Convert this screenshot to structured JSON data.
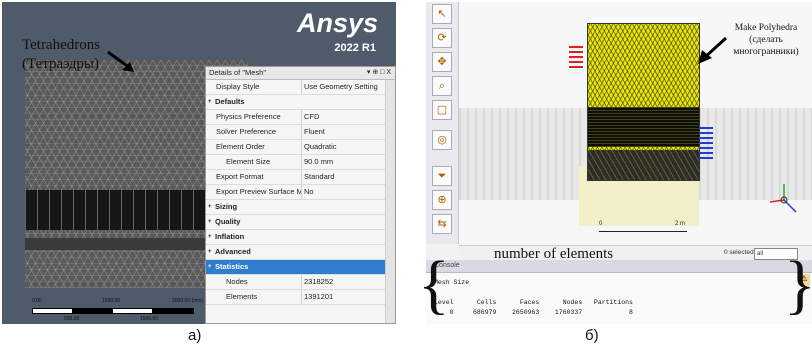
{
  "panel_a": {
    "logo": "Ansys",
    "version": "2022 R1",
    "annotation": [
      "Tetrahedrons",
      "(Тетраэдры)"
    ],
    "details": {
      "title": "Details of \"Mesh\"",
      "controls": "▾ ⊕ □ X",
      "rows": [
        {
          "key": "Display Style",
          "value": "Use Geometry Setting",
          "type": "row"
        },
        {
          "key": "Defaults",
          "value": "",
          "type": "grp"
        },
        {
          "key": "Physics Preference",
          "value": "CFD",
          "type": "row"
        },
        {
          "key": "Solver Preference",
          "value": "Fluent",
          "type": "row"
        },
        {
          "key": "Element Order",
          "value": "Quadratic",
          "type": "row"
        },
        {
          "key": "Element Size",
          "value": "90.0 mm",
          "type": "sub"
        },
        {
          "key": "Export Format",
          "value": "Standard",
          "type": "row"
        },
        {
          "key": "Export Preview Surface Mesh",
          "value": "No",
          "type": "row"
        },
        {
          "key": "Sizing",
          "value": "",
          "type": "grp"
        },
        {
          "key": "Quality",
          "value": "",
          "type": "grp"
        },
        {
          "key": "Inflation",
          "value": "",
          "type": "grp"
        },
        {
          "key": "Advanced",
          "value": "",
          "type": "grp"
        },
        {
          "key": "Statistics",
          "value": "",
          "type": "sel"
        },
        {
          "key": "Nodes",
          "value": "2318252",
          "type": "sub"
        },
        {
          "key": "Elements",
          "value": "1391201",
          "type": "sub"
        }
      ]
    },
    "scale": {
      "t0": "0.00",
      "t1": "1000.00",
      "t2": "2000.00 (mm)",
      "m1": "500.00",
      "m2": "1500.00"
    },
    "caption": "а)"
  },
  "panel_b": {
    "annotation": [
      "Make Polyhedra",
      "(сделать",
      "многогранники)"
    ],
    "ruler": [
      "0",
      "2 m"
    ],
    "status": {
      "selected": "0 selected",
      "filter": "all"
    },
    "console": {
      "tab": "Console",
      "heading": "number of elements",
      "lines": [
        "Mesh Size",
        "",
        "Level      Cells      Faces      Nodes   Partitions",
        "    0     686979    2650963    1760337            8"
      ]
    },
    "caption": "б)"
  },
  "colors": {
    "ansys_bg": "#4f5b6a",
    "polyhedra": "#e8e60a",
    "selected_row": "#2e7ed0"
  }
}
